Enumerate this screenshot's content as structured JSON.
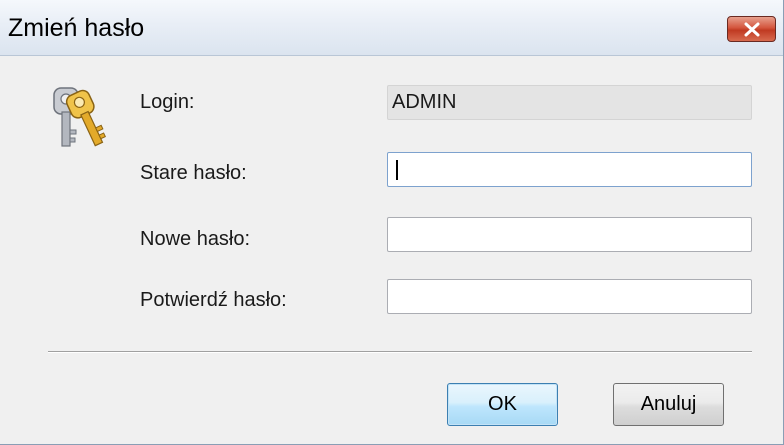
{
  "window": {
    "title": "Zmień hasło",
    "close_icon": "close-icon"
  },
  "form": {
    "icon": "keys-icon",
    "fields": [
      {
        "label": "Login:",
        "value": "ADMIN",
        "readonly": true
      },
      {
        "label": "Stare hasło:",
        "value": "",
        "focused": true
      },
      {
        "label": "Nowe hasło:",
        "value": ""
      },
      {
        "label": "Potwierdź hasło:",
        "value": ""
      }
    ]
  },
  "buttons": {
    "ok_label": "OK",
    "cancel_label": "Anuluj"
  },
  "colors": {
    "close_button": "#c9452d",
    "ok_button_border": "#3c7fb1",
    "readonly_field": "#e4e4e4"
  }
}
